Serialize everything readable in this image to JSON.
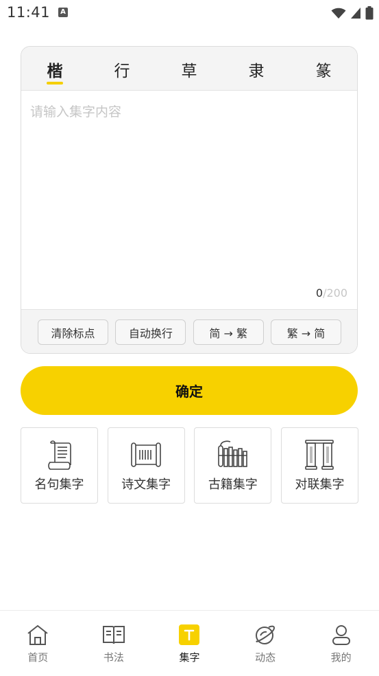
{
  "status_bar": {
    "time": "11:41",
    "notification_icon_letter": "A"
  },
  "tabs": [
    {
      "label": "楷",
      "active": true
    },
    {
      "label": "行",
      "active": false
    },
    {
      "label": "草",
      "active": false
    },
    {
      "label": "隶",
      "active": false
    },
    {
      "label": "篆",
      "active": false
    }
  ],
  "input": {
    "value": "",
    "placeholder": "请输入集字内容",
    "count": "0",
    "max": "/200"
  },
  "tools": {
    "clear_punct": "清除标点",
    "auto_wrap": "自动换行",
    "to_traditional": "简 → 繁",
    "to_simplified": "繁 → 简"
  },
  "confirm_label": "确定",
  "modes": [
    {
      "label": "名句集字",
      "icon": "scroll-icon"
    },
    {
      "label": "诗文集字",
      "icon": "unrolled-scroll-icon"
    },
    {
      "label": "古籍集字",
      "icon": "bamboo-slips-icon"
    },
    {
      "label": "对联集字",
      "icon": "couplet-icon"
    }
  ],
  "bottom_nav": [
    {
      "label": "首页",
      "icon": "home-icon",
      "active": false
    },
    {
      "label": "书法",
      "icon": "book-icon",
      "active": false
    },
    {
      "label": "集字",
      "icon": "collect-char-icon",
      "active": true
    },
    {
      "label": "动态",
      "icon": "planet-icon",
      "active": false
    },
    {
      "label": "我的",
      "icon": "user-icon",
      "active": false
    }
  ],
  "colors": {
    "accent": "#f7d100",
    "panel_bg": "#f4f4f4"
  }
}
